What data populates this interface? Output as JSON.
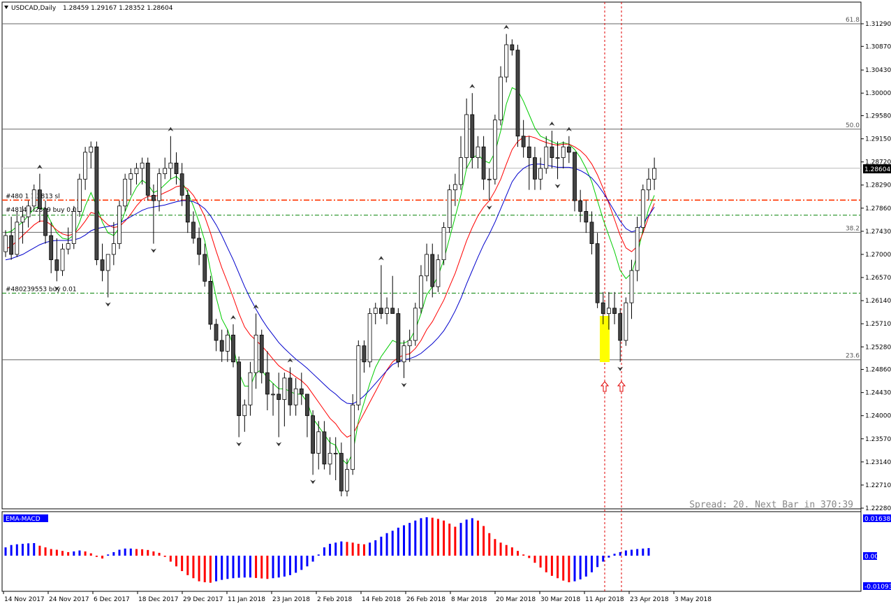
{
  "header": {
    "symbol_timeframe": "USDCAD,Daily",
    "ohlc": "1.28459 1.29167 1.28352 1.28604"
  },
  "price_axis": {
    "labels": [
      "1.31290",
      "1.30870",
      "1.30430",
      "1.30000",
      "1.29580",
      "1.29150",
      "1.28720",
      "1.28290",
      "1.27860",
      "1.27430",
      "1.27000",
      "1.26570",
      "1.26140",
      "1.25710",
      "1.25280",
      "1.24860",
      "1.24430",
      "1.24000",
      "1.23570",
      "1.23140",
      "1.22710",
      "1.22280"
    ],
    "current_price": "1.28604",
    "range": [
      1.2228,
      1.3139
    ]
  },
  "date_axis": [
    "14 Nov 2017",
    "24 Nov 2017",
    "6 Dec 2017",
    "18 Dec 2017",
    "29 Dec 2017",
    "11 Jan 2018",
    "23 Jan 2018",
    "2 Feb 2018",
    "14 Feb 2018",
    "26 Feb 2018",
    "8 Mar 2018",
    "20 Mar 2018",
    "30 Mar 2018",
    "11 Apr 2018",
    "23 Apr 2018",
    "3 May 2018"
  ],
  "fib_levels": [
    {
      "label": "61.8",
      "price": 1.3129
    },
    {
      "label": "50.0",
      "price": 1.2933
    },
    {
      "label": "38.2",
      "price": 1.2741
    },
    {
      "label": "23.6",
      "price": 1.2504
    }
  ],
  "order_lines": [
    {
      "label": "#480 1 1.2813 sl",
      "price": 1.2801,
      "color": "#ff3300"
    },
    {
      "label": "#4814 1.2819 buy 0.01",
      "price": 1.2773,
      "color": "#008000"
    },
    {
      "label": "#480239553 buy 0.01",
      "price": 1.2628,
      "color": "#008000"
    }
  ],
  "status_text": "Spread: 20. Next Bar in 370:39",
  "indicator": {
    "name": "EMA-MACD",
    "scale_top": "0.016380",
    "scale_mid": "0.00",
    "scale_bottom": "-0.010938",
    "hist": [
      0.0035,
      0.0045,
      0.0048,
      0.005,
      0.0052,
      0.0053,
      0.0042,
      0.0035,
      0.0028,
      0.0025,
      0.002,
      0.0015,
      0.0018,
      0.0022,
      0.0018,
      0.001,
      -0.0005,
      -0.0012,
      0.0005,
      0.0015,
      0.0025,
      0.003,
      0.003,
      0.0028,
      0.0027,
      0.0024,
      0.0018,
      0.0012,
      -0.0005,
      -0.0025,
      -0.0045,
      -0.0065,
      -0.0082,
      -0.0095,
      -0.0108,
      -0.0112,
      -0.0114,
      -0.0108,
      -0.0102,
      -0.0098,
      -0.0095,
      -0.0093,
      -0.0092,
      -0.0092,
      -0.0094,
      -0.0096,
      -0.0098,
      -0.0095,
      -0.0092,
      -0.0088,
      -0.0082,
      -0.0072,
      -0.006,
      -0.0045,
      -0.0025,
      0.0005,
      0.0035,
      0.005,
      0.0055,
      0.006,
      0.0058,
      0.0055,
      0.005,
      0.0048,
      0.0055,
      0.0065,
      0.008,
      0.0095,
      0.0105,
      0.0118,
      0.0128,
      0.0138,
      0.0148,
      0.0158,
      0.0162,
      0.016,
      0.0155,
      0.0148,
      0.0135,
      0.0122,
      0.0138,
      0.0152,
      0.0158,
      0.0148,
      0.0125,
      0.0095,
      0.007,
      0.0055,
      0.0045,
      0.0035,
      0.002,
      0.0005,
      -0.001,
      -0.003,
      -0.005,
      -0.007,
      -0.0085,
      -0.0095,
      -0.0105,
      -0.0112,
      -0.0108,
      -0.01,
      -0.0088,
      -0.007,
      -0.0048,
      -0.0025,
      -0.0008,
      0.0008,
      0.0015,
      0.0022,
      0.0025,
      0.0028,
      0.003,
      0.0032
    ]
  },
  "chart_data": {
    "type": "candlestick",
    "symbol": "USDCAD",
    "timeframe": "Daily",
    "y_range": [
      1.2228,
      1.3139
    ],
    "candles": [
      [
        1.2705,
        1.2745,
        1.2695,
        1.2735
      ],
      [
        1.2735,
        1.277,
        1.269,
        1.27
      ],
      [
        1.27,
        1.278,
        1.2695,
        1.276
      ],
      [
        1.276,
        1.279,
        1.272,
        1.277
      ],
      [
        1.277,
        1.28,
        1.275,
        1.279
      ],
      [
        1.279,
        1.283,
        1.278,
        1.282
      ],
      [
        1.282,
        1.285,
        1.276,
        1.2785
      ],
      [
        1.2785,
        1.28,
        1.272,
        1.2735
      ],
      [
        1.2735,
        1.276,
        1.2665,
        1.269
      ],
      [
        1.269,
        1.273,
        1.265,
        1.267
      ],
      [
        1.267,
        1.272,
        1.266,
        1.271
      ],
      [
        1.271,
        1.275,
        1.27,
        1.272
      ],
      [
        1.272,
        1.279,
        1.271,
        1.278
      ],
      [
        1.278,
        1.285,
        1.277,
        1.284
      ],
      [
        1.284,
        1.29,
        1.282,
        1.289
      ],
      [
        1.289,
        1.291,
        1.286,
        1.29
      ],
      [
        1.29,
        1.291,
        1.268,
        1.269
      ],
      [
        1.269,
        1.272,
        1.265,
        1.267
      ],
      [
        1.267,
        1.27,
        1.262,
        1.27
      ],
      [
        1.27,
        1.276,
        1.268,
        1.272
      ],
      [
        1.272,
        1.28,
        1.271,
        1.279
      ],
      [
        1.279,
        1.285,
        1.278,
        1.284
      ],
      [
        1.284,
        1.286,
        1.281,
        1.285
      ],
      [
        1.285,
        1.287,
        1.283,
        1.286
      ],
      [
        1.286,
        1.288,
        1.283,
        1.287
      ],
      [
        1.287,
        1.288,
        1.28,
        1.281
      ],
      [
        1.281,
        1.283,
        1.272,
        1.28
      ],
      [
        1.28,
        1.286,
        1.278,
        1.285
      ],
      [
        1.285,
        1.288,
        1.284,
        1.286
      ],
      [
        1.286,
        1.292,
        1.284,
        1.287
      ],
      [
        1.287,
        1.289,
        1.283,
        1.285
      ],
      [
        1.285,
        1.287,
        1.279,
        1.281
      ],
      [
        1.281,
        1.282,
        1.274,
        1.276
      ],
      [
        1.276,
        1.278,
        1.272,
        1.273
      ],
      [
        1.273,
        1.275,
        1.268,
        1.27
      ],
      [
        1.27,
        1.272,
        1.264,
        1.265
      ],
      [
        1.265,
        1.266,
        1.256,
        1.257
      ],
      [
        1.257,
        1.258,
        1.252,
        1.254
      ],
      [
        1.254,
        1.256,
        1.25,
        1.252
      ],
      [
        1.252,
        1.256,
        1.25,
        1.255
      ],
      [
        1.255,
        1.257,
        1.249,
        1.25
      ],
      [
        1.25,
        1.251,
        1.236,
        1.24
      ],
      [
        1.24,
        1.243,
        1.237,
        1.242
      ],
      [
        1.242,
        1.25,
        1.24,
        1.248
      ],
      [
        1.248,
        1.259,
        1.245,
        1.255
      ],
      [
        1.255,
        1.256,
        1.246,
        1.248
      ],
      [
        1.248,
        1.252,
        1.241,
        1.244
      ],
      [
        1.244,
        1.246,
        1.24,
        1.244
      ],
      [
        1.244,
        1.248,
        1.236,
        1.243
      ],
      [
        1.243,
        1.248,
        1.238,
        1.247
      ],
      [
        1.247,
        1.249,
        1.24,
        1.242
      ],
      [
        1.242,
        1.247,
        1.24,
        1.245
      ],
      [
        1.245,
        1.248,
        1.242,
        1.244
      ],
      [
        1.244,
        1.244,
        1.236,
        1.24
      ],
      [
        1.24,
        1.241,
        1.229,
        1.233
      ],
      [
        1.233,
        1.239,
        1.23,
        1.237
      ],
      [
        1.237,
        1.239,
        1.23,
        1.231
      ],
      [
        1.231,
        1.236,
        1.229,
        1.233
      ],
      [
        1.233,
        1.236,
        1.228,
        1.233
      ],
      [
        1.233,
        1.235,
        1.225,
        1.226
      ],
      [
        1.226,
        1.232,
        1.225,
        1.23
      ],
      [
        1.23,
        1.244,
        1.229,
        1.242
      ],
      [
        1.242,
        1.254,
        1.241,
        1.253
      ],
      [
        1.253,
        1.254,
        1.248,
        1.25
      ],
      [
        1.25,
        1.26,
        1.249,
        1.259
      ],
      [
        1.259,
        1.261,
        1.257,
        1.26
      ],
      [
        1.26,
        1.268,
        1.258,
        1.259
      ],
      [
        1.259,
        1.262,
        1.257,
        1.26
      ],
      [
        1.26,
        1.266,
        1.259,
        1.259
      ],
      [
        1.259,
        1.26,
        1.249,
        1.25
      ],
      [
        1.25,
        1.254,
        1.247,
        1.253
      ],
      [
        1.253,
        1.256,
        1.25,
        1.254
      ],
      [
        1.254,
        1.261,
        1.253,
        1.26
      ],
      [
        1.26,
        1.268,
        1.259,
        1.266
      ],
      [
        1.266,
        1.272,
        1.265,
        1.27
      ],
      [
        1.27,
        1.272,
        1.262,
        1.264
      ],
      [
        1.264,
        1.27,
        1.263,
        1.269
      ],
      [
        1.269,
        1.276,
        1.268,
        1.275
      ],
      [
        1.275,
        1.283,
        1.274,
        1.282
      ],
      [
        1.282,
        1.285,
        1.279,
        1.283
      ],
      [
        1.283,
        1.292,
        1.282,
        1.288
      ],
      [
        1.288,
        1.299,
        1.286,
        1.296
      ],
      [
        1.296,
        1.3,
        1.286,
        1.288
      ],
      [
        1.288,
        1.292,
        1.286,
        1.29
      ],
      [
        1.29,
        1.292,
        1.282,
        1.284
      ],
      [
        1.284,
        1.286,
        1.28,
        1.284
      ],
      [
        1.284,
        1.296,
        1.283,
        1.295
      ],
      [
        1.295,
        1.305,
        1.294,
        1.303
      ],
      [
        1.303,
        1.311,
        1.302,
        1.309
      ],
      [
        1.309,
        1.31,
        1.307,
        1.308
      ],
      [
        1.308,
        1.309,
        1.29,
        1.292
      ],
      [
        1.292,
        1.295,
        1.288,
        1.29
      ],
      [
        1.29,
        1.292,
        1.282,
        1.288
      ],
      [
        1.288,
        1.29,
        1.282,
        1.284
      ],
      [
        1.284,
        1.288,
        1.282,
        1.286
      ],
      [
        1.286,
        1.292,
        1.285,
        1.29
      ],
      [
        1.29,
        1.293,
        1.286,
        1.288
      ],
      [
        1.288,
        1.291,
        1.284,
        1.288
      ],
      [
        1.288,
        1.291,
        1.286,
        1.29
      ],
      [
        1.29,
        1.292,
        1.287,
        1.289
      ],
      [
        1.289,
        1.289,
        1.278,
        1.28
      ],
      [
        1.28,
        1.282,
        1.276,
        1.278
      ],
      [
        1.278,
        1.28,
        1.274,
        1.276
      ],
      [
        1.276,
        1.278,
        1.27,
        1.272
      ],
      [
        1.272,
        1.274,
        1.26,
        1.261
      ],
      [
        1.261,
        1.263,
        1.257,
        1.259
      ],
      [
        1.259,
        1.263,
        1.256,
        1.26
      ],
      [
        1.26,
        1.263,
        1.257,
        1.259
      ],
      [
        1.259,
        1.26,
        1.25,
        1.254
      ],
      [
        1.254,
        1.262,
        1.253,
        1.261
      ],
      [
        1.261,
        1.269,
        1.258,
        1.267
      ],
      [
        1.267,
        1.277,
        1.265,
        1.275
      ],
      [
        1.275,
        1.283,
        1.274,
        1.282
      ],
      [
        1.282,
        1.286,
        1.28,
        1.284
      ],
      [
        1.284,
        1.288,
        1.282,
        1.286
      ]
    ],
    "series": [
      {
        "name": "MA fast",
        "color": "#00cc00",
        "values": [
          1.274,
          1.2743,
          1.2752,
          1.276,
          1.2772,
          1.2785,
          1.279,
          1.278,
          1.276,
          1.274,
          1.273,
          1.2728,
          1.2736,
          1.276,
          1.279,
          1.2815,
          1.279,
          1.276,
          1.274,
          1.2735,
          1.275,
          1.278,
          1.2805,
          1.2825,
          1.2838,
          1.283,
          1.2815,
          1.282,
          1.283,
          1.284,
          1.2845,
          1.2835,
          1.2815,
          1.279,
          1.276,
          1.2725,
          1.267,
          1.262,
          1.258,
          1.256,
          1.253,
          1.248,
          1.2455,
          1.2455,
          1.248,
          1.2485,
          1.247,
          1.246,
          1.245,
          1.245,
          1.2445,
          1.244,
          1.244,
          1.2425,
          1.2395,
          1.238,
          1.2365,
          1.235,
          1.2345,
          1.232,
          1.231,
          1.233,
          1.239,
          1.2425,
          1.246,
          1.249,
          1.251,
          1.2525,
          1.254,
          1.2535,
          1.2535,
          1.254,
          1.256,
          1.259,
          1.2625,
          1.264,
          1.266,
          1.269,
          1.273,
          1.277,
          1.281,
          1.286,
          1.288,
          1.2885,
          1.2875,
          1.287,
          1.289,
          1.293,
          1.298,
          1.301,
          1.3005,
          1.2985,
          1.296,
          1.2935,
          1.292,
          1.2915,
          1.291,
          1.2905,
          1.2908,
          1.2905,
          1.2895,
          1.288,
          1.286,
          1.2835,
          1.28,
          1.2765,
          1.2735,
          1.2705,
          1.267,
          1.2655,
          1.2665,
          1.27,
          1.2745,
          1.2785,
          1.281
        ]
      },
      {
        "name": "MA mid",
        "color": "#ff0000",
        "values": [
          1.271,
          1.2715,
          1.2725,
          1.2735,
          1.2745,
          1.2755,
          1.2762,
          1.2762,
          1.2755,
          1.2745,
          1.2738,
          1.2735,
          1.2738,
          1.2748,
          1.2762,
          1.2778,
          1.2775,
          1.2765,
          1.2755,
          1.275,
          1.2752,
          1.2762,
          1.2775,
          1.279,
          1.2802,
          1.2808,
          1.2808,
          1.281,
          1.2815,
          1.282,
          1.2826,
          1.2828,
          1.2822,
          1.281,
          1.2792,
          1.277,
          1.274,
          1.2706,
          1.2675,
          1.2648,
          1.262,
          1.259,
          1.2565,
          1.255,
          1.254,
          1.253,
          1.2518,
          1.2505,
          1.2493,
          1.2485,
          1.248,
          1.2472,
          1.2465,
          1.2455,
          1.244,
          1.2425,
          1.241,
          1.2395,
          1.2385,
          1.237,
          1.236,
          1.2365,
          1.2385,
          1.2405,
          1.2425,
          1.2445,
          1.2465,
          1.2485,
          1.25,
          1.2508,
          1.2513,
          1.2515,
          1.2525,
          1.254,
          1.256,
          1.2575,
          1.2595,
          1.2615,
          1.264,
          1.2665,
          1.2695,
          1.2725,
          1.275,
          1.2772,
          1.2788,
          1.28,
          1.2818,
          1.284,
          1.2868,
          1.2895,
          1.291,
          1.2918,
          1.292,
          1.2917,
          1.2912,
          1.2908,
          1.2905,
          1.2903,
          1.2905,
          1.2905,
          1.29,
          1.2893,
          1.2883,
          1.2868,
          1.2848,
          1.2823,
          1.2795,
          1.2765,
          1.2735,
          1.2712,
          1.2705,
          1.2715,
          1.274,
          1.277,
          1.2795
        ]
      },
      {
        "name": "MA slow",
        "color": "#0000cc",
        "values": [
          1.269,
          1.2692,
          1.2696,
          1.27,
          1.2706,
          1.2712,
          1.2718,
          1.2722,
          1.2725,
          1.2726,
          1.2726,
          1.2726,
          1.2727,
          1.273,
          1.2736,
          1.2744,
          1.2748,
          1.275,
          1.2752,
          1.2754,
          1.2758,
          1.2764,
          1.277,
          1.2776,
          1.2782,
          1.2786,
          1.2788,
          1.279,
          1.2792,
          1.2795,
          1.2798,
          1.28,
          1.28,
          1.2798,
          1.2793,
          1.2785,
          1.2772,
          1.2755,
          1.2735,
          1.2712,
          1.269,
          1.2665,
          1.264,
          1.2618,
          1.2598,
          1.258,
          1.2564,
          1.255,
          1.2536,
          1.2525,
          1.2515,
          1.2505,
          1.2497,
          1.2488,
          1.2478,
          1.2468,
          1.2458,
          1.2448,
          1.244,
          1.243,
          1.2423,
          1.2422,
          1.2428,
          1.2437,
          1.2448,
          1.246,
          1.2472,
          1.2484,
          1.2495,
          1.25,
          1.2504,
          1.2506,
          1.251,
          1.2516,
          1.2525,
          1.2534,
          1.2545,
          1.2558,
          1.2575,
          1.2595,
          1.2618,
          1.2645,
          1.267,
          1.2695,
          1.2718,
          1.2738,
          1.276,
          1.2785,
          1.281,
          1.2835,
          1.285,
          1.286,
          1.2866,
          1.2868,
          1.2868,
          1.2866,
          1.2864,
          1.2862,
          1.2862,
          1.2862,
          1.286,
          1.2856,
          1.285,
          1.2842,
          1.283,
          1.2815,
          1.2798,
          1.278,
          1.2762,
          1.2748,
          1.2742,
          1.2745,
          1.2757,
          1.2772,
          1.2788
        ]
      }
    ]
  }
}
